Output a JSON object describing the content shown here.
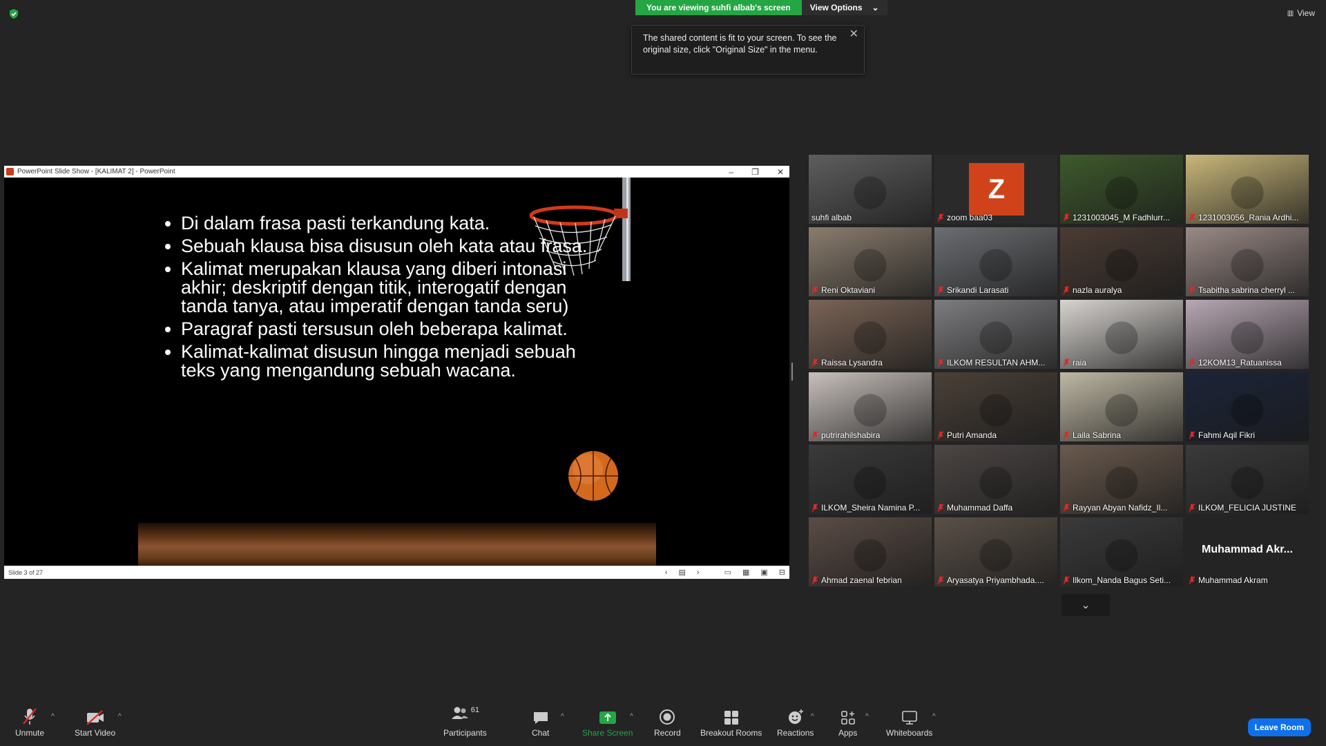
{
  "top": {
    "viewing": "You are viewing suhfi albab's screen",
    "view_options": "View Options",
    "view": "View"
  },
  "tooltip": {
    "text": "The shared content is fit to your screen. To see the original size, click \"Original Size\" in the menu."
  },
  "ppt": {
    "title": "PowerPoint Slide Show - [KALIMAT 2] - PowerPoint",
    "status": "Slide 3 of 27",
    "bullets": [
      "Di dalam frasa pasti terkandung kata.",
      "Sebuah klausa bisa disusun oleh kata atau frasa.",
      "Kalimat merupakan klausa yang diberi intonasi akhir; deskriptif dengan titik, interogatif dengan tanda tanya, atau imperatif dengan tanda seru)",
      "Paragraf pasti tersusun oleh beberapa kalimat.",
      "Kalimat-kalimat disusun hingga menjadi sebuah teks yang mengandung sebuah wacana."
    ]
  },
  "participants": [
    {
      "name": "suhfi albab"
    },
    {
      "name": "zoom baa03",
      "initial": "Z"
    },
    {
      "name": "1231003045_M Fadhlurr..."
    },
    {
      "name": "1231003056_Rania Ardhi..."
    },
    {
      "name": "Reni Oktaviani"
    },
    {
      "name": "Srikandi Larasati"
    },
    {
      "name": "nazla auralya"
    },
    {
      "name": "Tsabitha sabrina cherryl ..."
    },
    {
      "name": "Raissa Lysandra"
    },
    {
      "name": "ILKOM RESULTAN AHM..."
    },
    {
      "name": "raia"
    },
    {
      "name": "12KOM13_Ratuanissa"
    },
    {
      "name": "putrirahilshabira"
    },
    {
      "name": "Putri Amanda"
    },
    {
      "name": "Laila Sabrina"
    },
    {
      "name": "Fahmi Aqil Fikri"
    },
    {
      "name": "ILKOM_Sheira Namina P..."
    },
    {
      "name": "Muhammad Daffa"
    },
    {
      "name": "Rayyan Abyan Nafidz_Il..."
    },
    {
      "name": "ILKOM_FELICIA JUSTINE"
    },
    {
      "name": "Ahmad zaenal febrian"
    },
    {
      "name": "Aryasatya Priyambhada...."
    },
    {
      "name": "Ilkom_Nanda Bagus Seti..."
    },
    {
      "name": "Muhammad Akram",
      "big": "Muhammad  Akr..."
    }
  ],
  "toolbar": {
    "unmute": "Unmute",
    "start_video": "Start Video",
    "participants": "Participants",
    "participants_count": "61",
    "chat": "Chat",
    "share": "Share Screen",
    "record": "Record",
    "breakout": "Breakout Rooms",
    "reactions": "Reactions",
    "apps": "Apps",
    "whiteboards": "Whiteboards",
    "leave": "Leave Room"
  },
  "colors": {
    "share_green": "#24a644",
    "active_speaker": "#c8d62f",
    "leave_blue": "#0e71eb",
    "avatar_orange": "#d0431a"
  }
}
